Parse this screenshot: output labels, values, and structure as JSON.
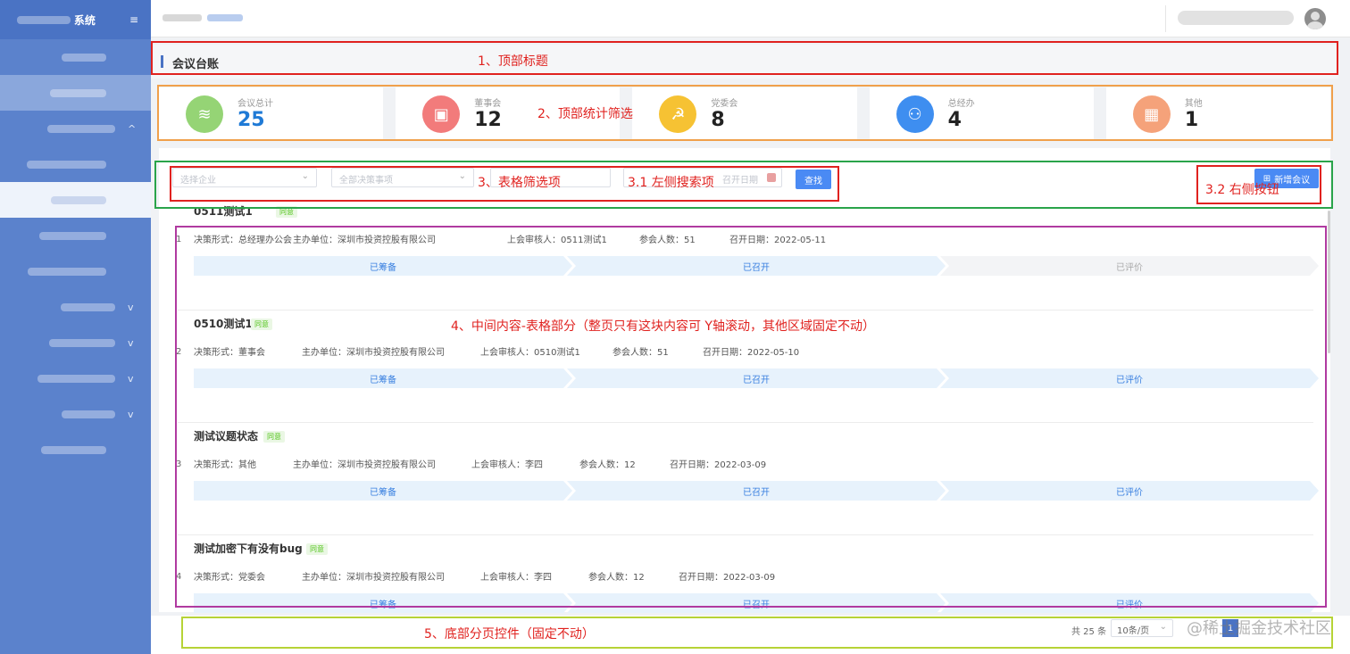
{
  "page": {
    "title": "会议台账"
  },
  "sidebar": {
    "logo_text": "系统",
    "menu_icon": "≡",
    "items": [
      {
        "label": "",
        "chevron": ""
      },
      {
        "label": "",
        "chevron": ""
      },
      {
        "label": "",
        "chevron": "^"
      },
      {
        "label": "",
        "chevron": ""
      },
      {
        "label": "",
        "chevron": ""
      },
      {
        "label": "",
        "chevron": ""
      },
      {
        "label": "",
        "chevron": ""
      },
      {
        "label": "",
        "chevron": "v"
      },
      {
        "label": "",
        "chevron": "v"
      },
      {
        "label": "",
        "chevron": "v"
      },
      {
        "label": "",
        "chevron": "v"
      },
      {
        "label": "",
        "chevron": ""
      }
    ]
  },
  "stats": [
    {
      "label": "会议总计",
      "value": "25",
      "color": "#95d475",
      "icon": "layers-icon",
      "glyph": "≋",
      "value_color": "#1f7ad6"
    },
    {
      "label": "董事会",
      "value": "12",
      "color": "#f27b7b",
      "icon": "chip-icon",
      "glyph": "▣",
      "value_color": "#222"
    },
    {
      "label": "党委会",
      "value": "8",
      "color": "#f6c233",
      "icon": "party-emblem-icon",
      "glyph": "☭",
      "value_color": "#222"
    },
    {
      "label": "总经办",
      "value": "4",
      "color": "#3e8ef0",
      "icon": "org-chart-icon",
      "glyph": "⚇",
      "value_color": "#222"
    },
    {
      "label": "其他",
      "value": "1",
      "color": "#f5a27a",
      "icon": "grid-icon",
      "glyph": "▦",
      "value_color": "#222"
    }
  ],
  "filters": {
    "company_placeholder": "选择企业",
    "matter_placeholder": "全部决策事项",
    "keyword_placeholder": "",
    "date_placeholder": "召开日期",
    "search_label": "查找",
    "add_label": "新增会议"
  },
  "records": [
    {
      "index": "1",
      "title": "0511测试1",
      "tag": "同意",
      "form": "决策形式：总经理办公会",
      "unit": "主办单位：深圳市投资控股有限公司",
      "reviewer": "上会审核人：0511测试1",
      "count": "参会人数：51",
      "date": "召开日期：2022-05-11",
      "steps": [
        {
          "label": "已筹备",
          "done": true
        },
        {
          "label": "已召开",
          "done": true
        },
        {
          "label": "已评价",
          "done": false
        }
      ]
    },
    {
      "index": "2",
      "title": "0510测试1",
      "tag": "同意",
      "form": "决策形式：董事会",
      "unit": "主办单位：深圳市投资控股有限公司",
      "reviewer": "上会审核人：0510测试1",
      "count": "参会人数：51",
      "date": "召开日期：2022-05-10",
      "steps": [
        {
          "label": "已筹备",
          "done": true
        },
        {
          "label": "已召开",
          "done": true
        },
        {
          "label": "已评价",
          "done": true
        }
      ]
    },
    {
      "index": "3",
      "title": "测试议题状态",
      "tag": "同意",
      "form": "决策形式：其他",
      "unit": "主办单位：深圳市投资控股有限公司",
      "reviewer": "上会审核人：李四",
      "count": "参会人数：12",
      "date": "召开日期：2022-03-09",
      "steps": [
        {
          "label": "已筹备",
          "done": true
        },
        {
          "label": "已召开",
          "done": true
        },
        {
          "label": "已评价",
          "done": true
        }
      ]
    },
    {
      "index": "4",
      "title": "测试加密下有没有bug",
      "tag": "同意",
      "form": "决策形式：党委会",
      "unit": "主办单位：深圳市投资控股有限公司",
      "reviewer": "上会审核人：李四",
      "count": "参会人数：12",
      "date": "召开日期：2022-03-09",
      "steps": [
        {
          "label": "已筹备",
          "done": true
        },
        {
          "label": "已召开",
          "done": true
        },
        {
          "label": "已评价",
          "done": true
        }
      ]
    }
  ],
  "pagination": {
    "total": "共 25 条",
    "page_size": "10条/页",
    "current": "1"
  },
  "watermark": "@稀土掘金技术社区",
  "annotations": {
    "a1": "1、顶部标题",
    "a2": "2、顶部统计筛选",
    "a3": "3、表格筛选项",
    "a31": "3.1 左侧搜索项",
    "a32": "3.2 右侧按钮",
    "a4": "4、中间内容-表格部分（整页只有这块内容可 Y轴滚动，其他区域固定不动）",
    "a5": "5、底部分页控件（固定不动）"
  }
}
